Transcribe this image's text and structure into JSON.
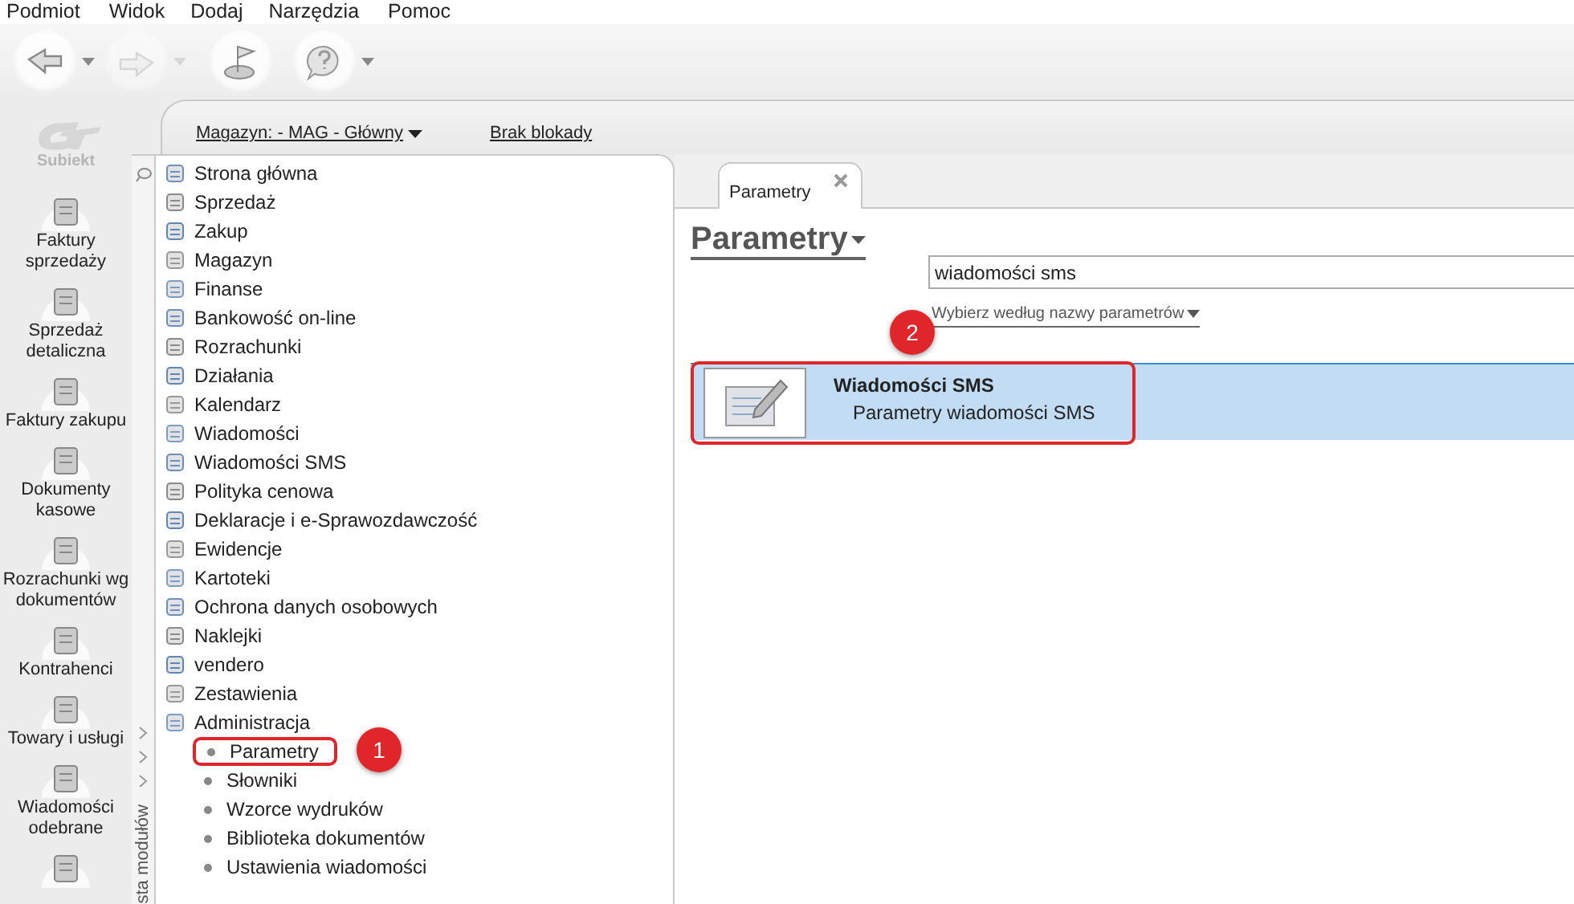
{
  "menu_bar": [
    "Podmiot",
    "Widok",
    "Dodaj",
    "Narzędzia",
    "Pomoc"
  ],
  "toolbar": [
    {
      "kind": "back",
      "disabled": false,
      "dropdown": true
    },
    {
      "kind": "forward",
      "disabled": true,
      "dropdown": true
    },
    {
      "kind": "flag",
      "disabled": false,
      "dropdown": false
    },
    {
      "kind": "help",
      "disabled": false,
      "dropdown": true
    }
  ],
  "logo": {
    "text": "Subiekt"
  },
  "modules": [
    {
      "kind": "module",
      "label": "Faktury sprzedaży"
    },
    {
      "kind": "module",
      "label": "Sprzedaż detaliczna"
    },
    {
      "kind": "module",
      "label": "Faktury zakupu"
    },
    {
      "kind": "module",
      "label": "Dokumenty kasowe"
    },
    {
      "kind": "module",
      "label": "Rozrachunki wg dokumentów"
    },
    {
      "kind": "module",
      "label": "Kontrahenci"
    },
    {
      "kind": "module",
      "label": "Towary i usługi"
    },
    {
      "kind": "module",
      "label": "Wiadomości odebrane"
    },
    {
      "kind": "icon"
    }
  ],
  "header": {
    "warehouse": "Magazyn: - MAG - Główny",
    "lock": "Brak blokady"
  },
  "module_panel": {
    "vertical_label": "sta modułów",
    "items": [
      {
        "label": "Strona główna"
      },
      {
        "label": "Sprzedaż"
      },
      {
        "label": "Zakup"
      },
      {
        "label": "Magazyn"
      },
      {
        "label": "Finanse"
      },
      {
        "label": "Bankowość on-line"
      },
      {
        "label": "Rozrachunki"
      },
      {
        "label": "Działania"
      },
      {
        "label": "Kalendarz"
      },
      {
        "label": "Wiadomości"
      },
      {
        "label": "Wiadomości SMS"
      },
      {
        "label": "Polityka cenowa"
      },
      {
        "label": "Deklaracje i e-Sprawozdawczość"
      },
      {
        "label": "Ewidencje"
      },
      {
        "label": "Kartoteki"
      },
      {
        "label": "Ochrona danych osobowych"
      },
      {
        "label": "Naklejki"
      },
      {
        "label": "vendero"
      },
      {
        "label": "Zestawienia"
      },
      {
        "label": "Administracja",
        "expanded": true,
        "children": [
          {
            "label": "Parametry",
            "highlighted": true,
            "badge": "1"
          },
          {
            "label": "Słowniki",
            "highlighted": false
          },
          {
            "label": "Wzorce wydruków",
            "highlighted": false
          },
          {
            "label": "Biblioteka dokumentów",
            "highlighted": false
          },
          {
            "label": "Ustawienia wiadomości",
            "highlighted": false
          }
        ]
      }
    ]
  },
  "tabs": [
    {
      "label": "Parametry",
      "selected": true
    }
  ],
  "parameters": {
    "title": "Parametry",
    "search_value": "wiadomości sms",
    "filter_link": "Wybierz według nazwy parametrów",
    "results": [
      {
        "title": "Wiadomości SMS",
        "subtitle": "Parametry wiadomości SMS",
        "selected": true,
        "highlighted": true,
        "badge": "2"
      }
    ]
  }
}
